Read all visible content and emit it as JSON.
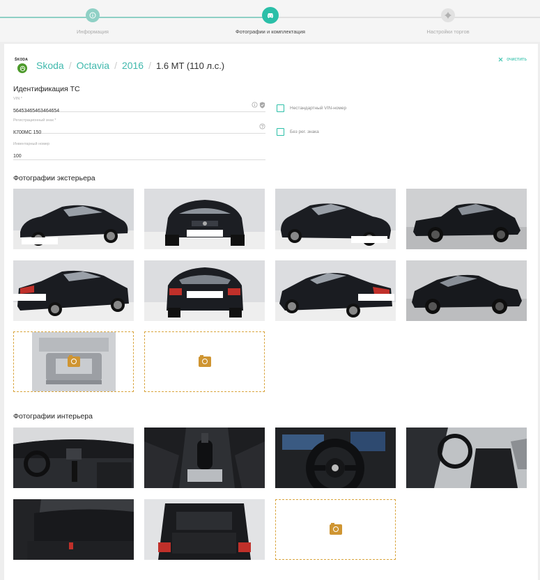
{
  "stepper": {
    "steps": [
      {
        "label": "Информация",
        "state": "done",
        "icon": "info-icon"
      },
      {
        "label": "Фотографии и комплектация",
        "state": "active",
        "icon": "car-icon"
      },
      {
        "label": "Настройки торгов",
        "state": "todo",
        "icon": "gear-icon"
      }
    ],
    "colors": {
      "done": "#8fd0c5",
      "active": "#2bbfa8",
      "todo": "#e2e2e2"
    }
  },
  "header": {
    "brand_logo_text": "ŠKODA",
    "breadcrumbs": [
      "Skoda",
      "Octavia",
      "2016"
    ],
    "modification": "1.6 MT (110 л.с.)",
    "clear_label": "очистить",
    "accent_color": "#40b9ad"
  },
  "identification": {
    "title": "Идентификация ТС",
    "vin": {
      "label": "VIN *",
      "value": "56453465463464654",
      "icons": [
        "info-circle-icon",
        "shield-check-icon"
      ]
    },
    "reg": {
      "label": "Регистрационный знак *",
      "value": "К700МС 150",
      "icons": [
        "question-circle-icon"
      ]
    },
    "inventory": {
      "label": "Инвентарный номер",
      "value": "100"
    },
    "checkbox_nonstandard_vin": {
      "label": "Нестандартный VIN-номер",
      "checked": false
    },
    "checkbox_no_plate": {
      "label": "Без рег. знака",
      "checked": false
    }
  },
  "exterior": {
    "title": "Фотографии экстерьера",
    "photos": [
      "front-left-view",
      "front-view",
      "front-right-view",
      "side-left-view",
      "rear-left-view",
      "rear-view",
      "rear-right-view",
      "side-right-view",
      "engine-bay"
    ],
    "upload_icon": "camera-icon"
  },
  "interior": {
    "title": "Фотографии интерьера",
    "photos": [
      "dashboard",
      "gear-shifter",
      "steering-wheel",
      "front-seat",
      "rear-seats",
      "trunk"
    ],
    "upload_icon": "camera-icon"
  }
}
